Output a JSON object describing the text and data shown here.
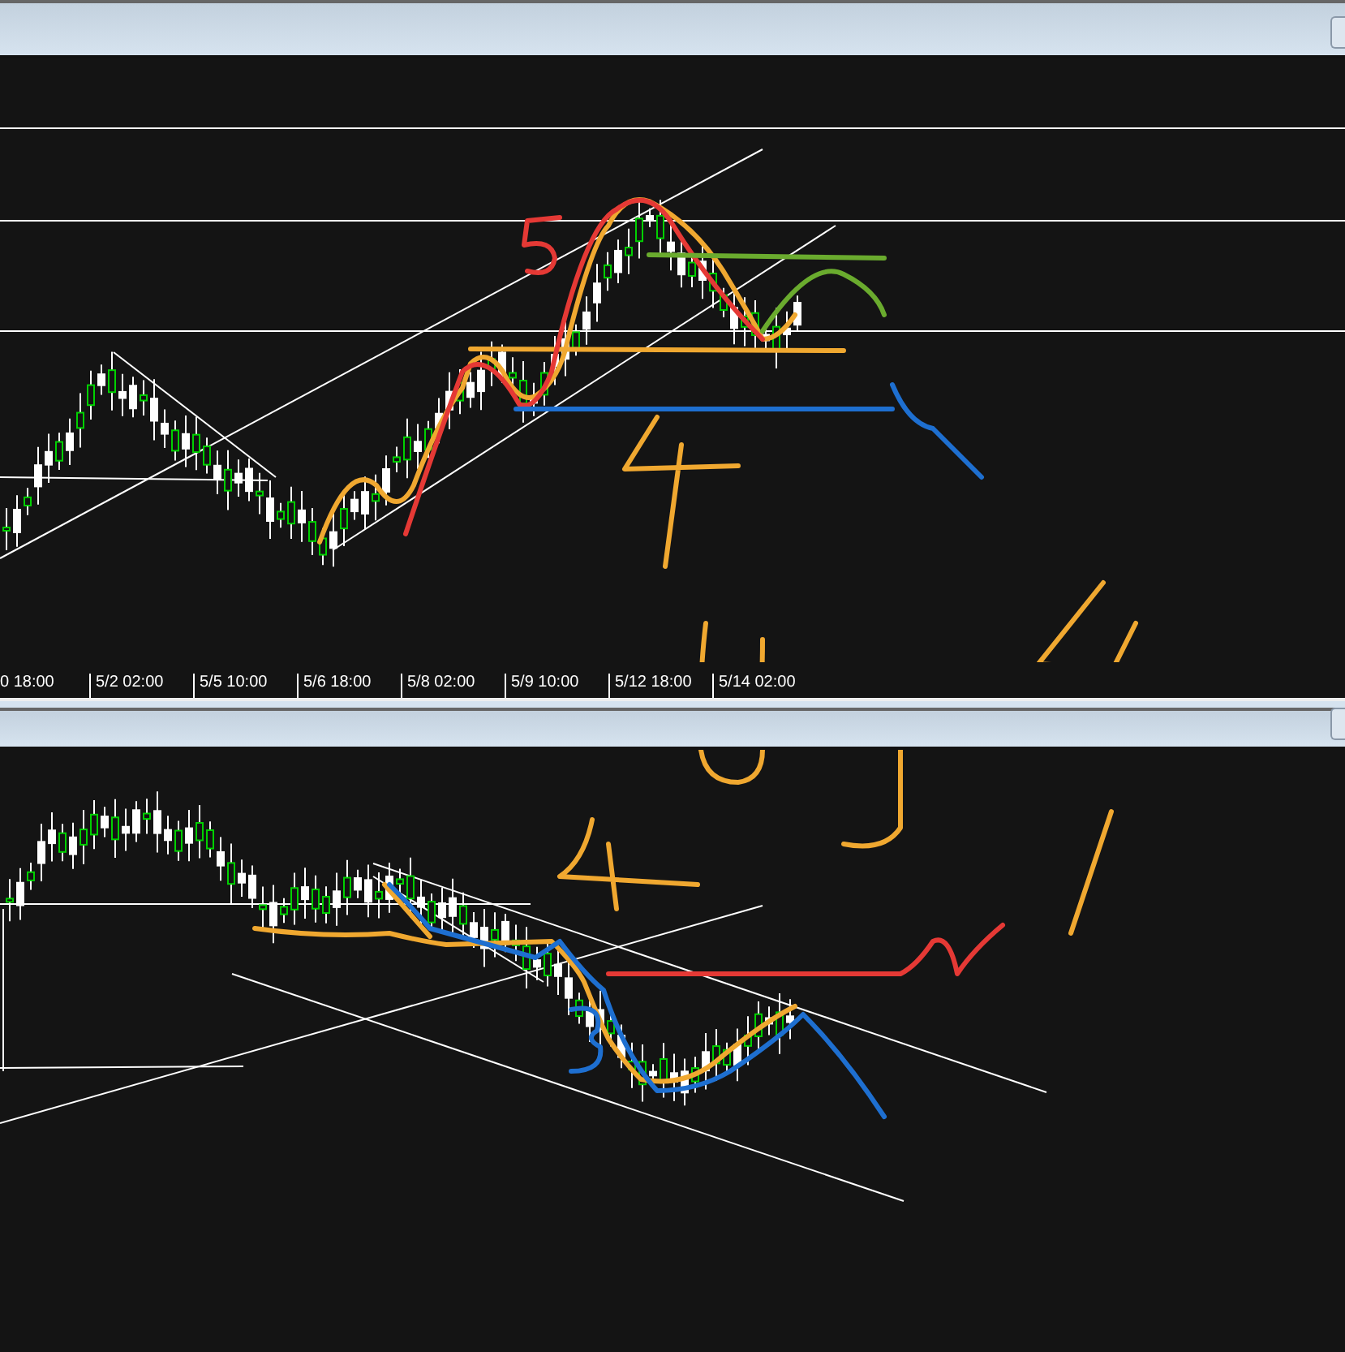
{
  "top_chart": {
    "time_axis": [
      "0 18:00",
      "5/2 02:00",
      "5/5 10:00",
      "5/6 18:00",
      "5/8 02:00",
      "5/9 10:00",
      "5/12 18:00",
      "5/14 02:00"
    ]
  }
}
